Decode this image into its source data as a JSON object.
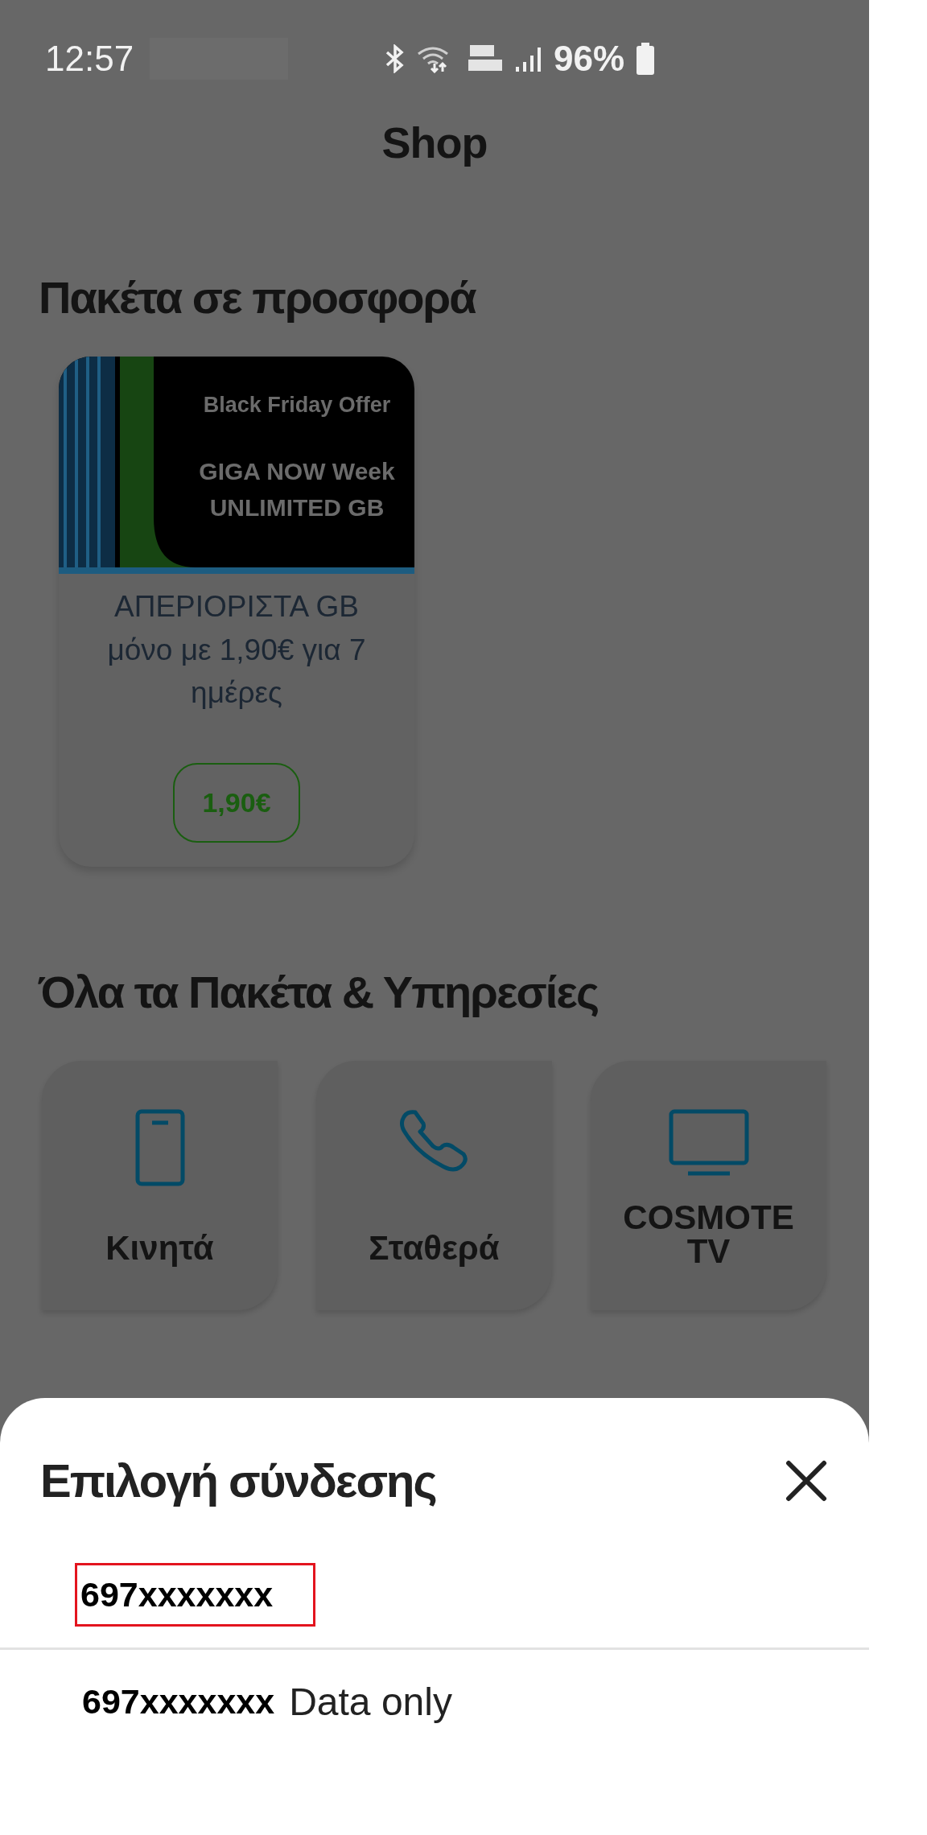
{
  "status_bar": {
    "time": "12:57",
    "battery": "96%"
  },
  "header": {
    "title": "Shop"
  },
  "offers": {
    "heading": "Πακέτα σε προσφορά",
    "cards": [
      {
        "kind": "picture",
        "banner_lines": [
          "Black Friday Offer",
          "GIGA NOW Week",
          "UNLIMITED GB"
        ],
        "description": "ΑΠΕΡΙΟΡΙΣΤΑ GB μόνο με 1,90€ για 7 ημέρες",
        "price": "1,90€"
      }
    ]
  },
  "services": {
    "heading": "Όλα τα Πακέτα & Υπηρεσίες",
    "tiles": [
      {
        "kind": "mobile",
        "label": "Κινητά"
      },
      {
        "kind": "landline",
        "label": "Σταθερά"
      },
      {
        "kind": "tv",
        "label": "COSMOTE TV"
      }
    ]
  },
  "sheet": {
    "title": "Επιλογή σύνδεσης",
    "items": [
      {
        "number": "697xxxxxxx",
        "selected": true
      },
      {
        "number": "697xxxxxxx",
        "note": "Data only",
        "selected": false
      }
    ]
  }
}
